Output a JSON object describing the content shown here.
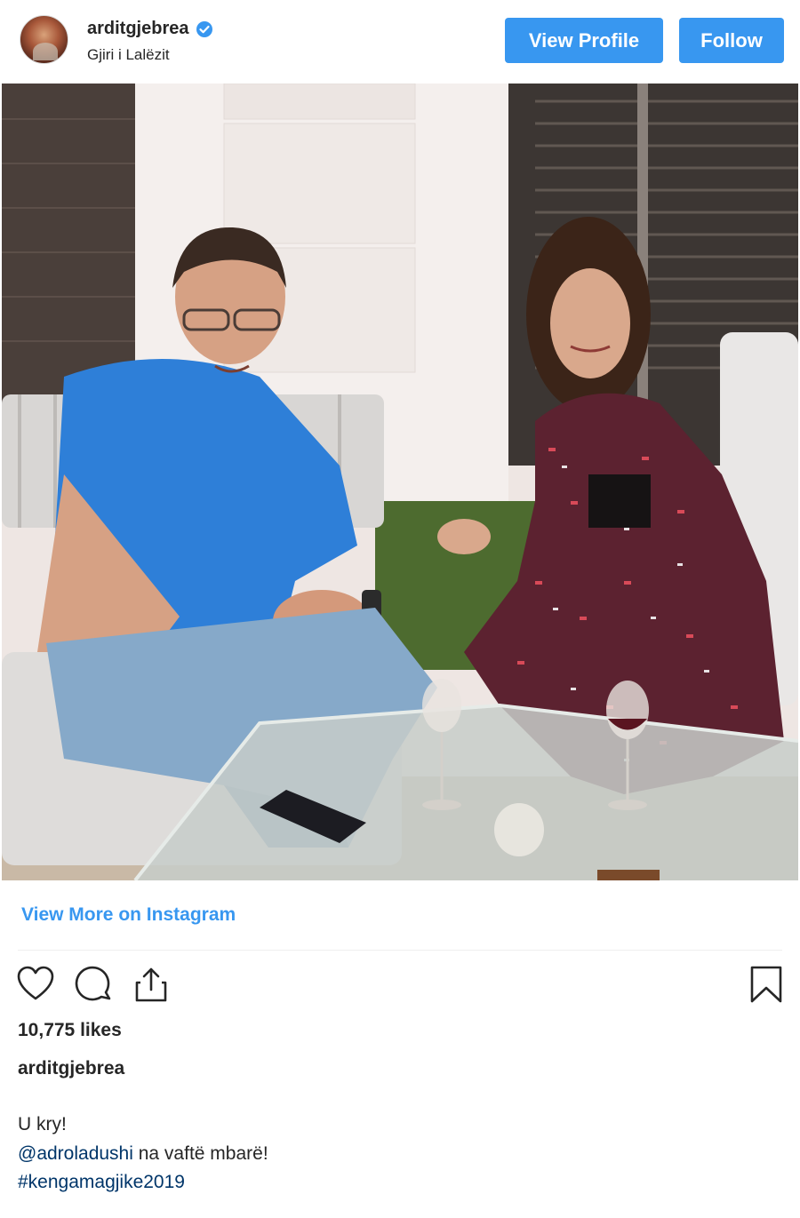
{
  "header": {
    "username": "arditgjebrea",
    "location": "Gjiri i Lalëzit",
    "view_profile_label": "View Profile",
    "follow_label": "Follow"
  },
  "post": {
    "view_more_label": "View More on Instagram",
    "likes": "10,775 likes",
    "caption_user": "arditgjebrea",
    "caption_line1": "U kry!",
    "mention": "@adroladushi",
    "caption_line2_rest": " na vaftë mbarë!",
    "hashtag": "#kengamagjike2019"
  },
  "icons": {
    "like": "heart-icon",
    "comment": "comment-icon",
    "share": "share-icon",
    "save": "bookmark-icon",
    "verified": "verified-badge-icon"
  },
  "colors": {
    "accent": "#3897f0",
    "link": "#003569",
    "text": "#262626"
  }
}
